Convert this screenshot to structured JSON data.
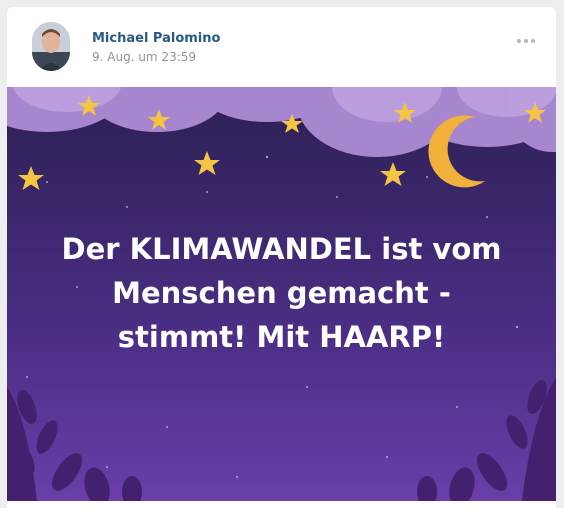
{
  "post": {
    "author": "Michael Palomino",
    "date": "9. Aug. um 23:59",
    "more_icon": "ellipsis-icon",
    "image": {
      "lines": [
        "Der KLIMAWANDEL ist vom",
        "Menschen gemacht -",
        "stimmt! Mit HAARP!"
      ],
      "colors": {
        "sky_top": "#2c2053",
        "sky_bottom": "#6a3ea8",
        "cloud": "#b89ad8",
        "star": "#f6c443",
        "moon": "#f2b13a",
        "leaves": "#43216e"
      }
    }
  }
}
